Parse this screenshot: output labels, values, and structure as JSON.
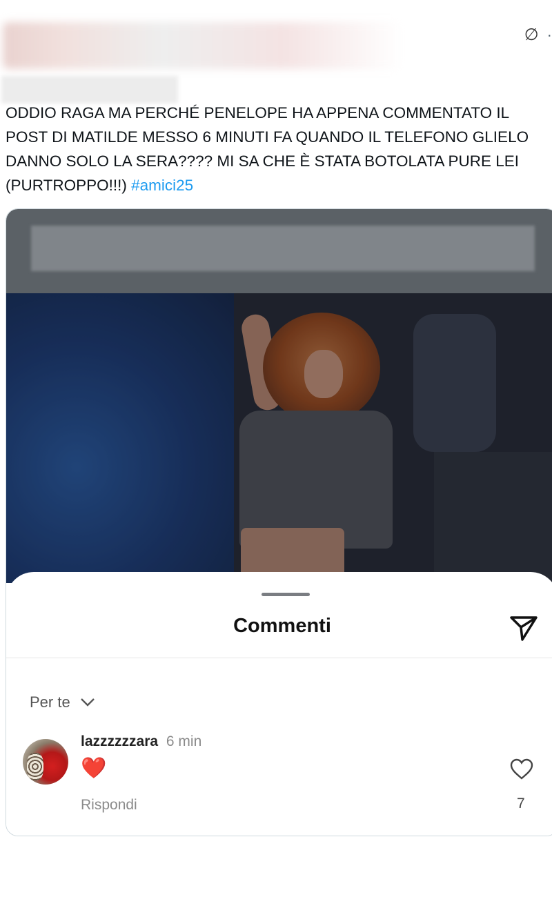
{
  "header": {
    "grok_icon": "grok-slash-circle-icon",
    "more_dot": "·"
  },
  "tweet": {
    "text": "ODDIO RAGA MA PERCHÉ PENELOPE HA APPENA COMMENTATO IL\nPOST DI MATILDE MESSO 6 MINUTI FA QUANDO IL TELEFONO GLIELO\nDANNO SOLO LA SERA???? MI SA CHE È STATA BOTOLATA PURE LEI\n(PURTROPPO!!!) ",
    "hashtag": "#amici25",
    "hashtag_color": "#1d9bf0"
  },
  "media": {
    "sheet": {
      "title": "Commenti",
      "send_icon": "send-paper-plane-icon",
      "filter_label": "Per te",
      "filter_icon": "chevron-down-icon"
    },
    "comment": {
      "username": "lazzzzzzara",
      "time": "6 min",
      "emoji": "❤️",
      "reply_label": "Rispondi",
      "like_count": "7",
      "like_icon": "heart-outline-icon"
    }
  },
  "colors": {
    "text": "#0f1419",
    "hashtag": "#1d9bf0",
    "muted": "#8a8a8a",
    "heart_red": "#e0242f"
  }
}
